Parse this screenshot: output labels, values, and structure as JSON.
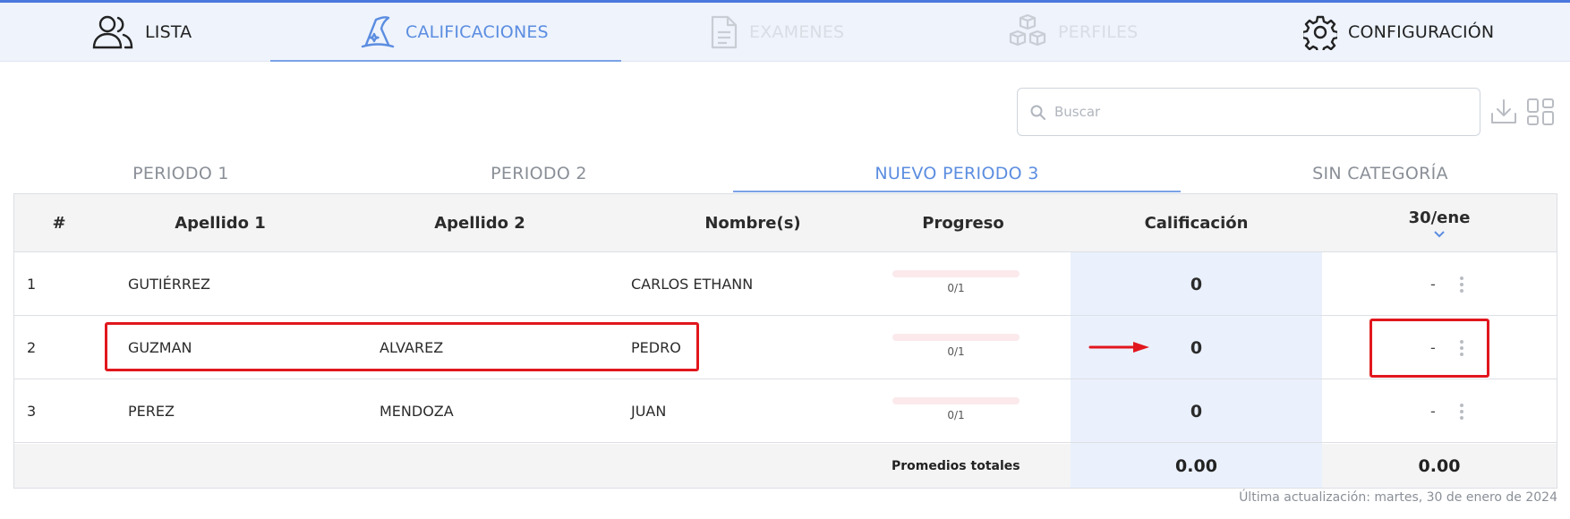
{
  "nav": {
    "items": [
      {
        "label": "LISTA",
        "icon": "users-icon"
      },
      {
        "label": "CALIFICACIONES",
        "icon": "wizard-hat-icon"
      },
      {
        "label": "EXAMENES",
        "icon": "document-icon"
      },
      {
        "label": "PERFILES",
        "icon": "cubes-icon"
      },
      {
        "label": "CONFIGURACIÓN",
        "icon": "gear-icon"
      }
    ],
    "active": "CALIFICACIONES"
  },
  "search": {
    "placeholder": "Buscar"
  },
  "tabs": {
    "items": [
      "PERIODO 1",
      "PERIODO 2",
      "NUEVO PERIODO 3",
      "SIN CATEGORÍA"
    ],
    "active": "NUEVO PERIODO 3"
  },
  "table": {
    "headers": [
      "#",
      "Apellido 1",
      "Apellido 2",
      "Nombre(s)",
      "Progreso",
      "Calificación",
      "30/ene"
    ],
    "rows": [
      {
        "num": "1",
        "apellido1": "GUTIÉRREZ",
        "apellido2": "",
        "nombre": "CARLOS ETHANN",
        "progreso": "0/1",
        "progress_fraction": 0,
        "calificacion": "0",
        "fecha": "-"
      },
      {
        "num": "2",
        "apellido1": "GUZMAN",
        "apellido2": "ALVAREZ",
        "nombre": "PEDRO",
        "progreso": "0/1",
        "progress_fraction": 0,
        "calificacion": "0",
        "fecha": "-"
      },
      {
        "num": "3",
        "apellido1": "PEREZ",
        "apellido2": "MENDOZA",
        "nombre": "JUAN",
        "progreso": "0/1",
        "progress_fraction": 0,
        "calificacion": "0",
        "fecha": "-"
      }
    ],
    "footer": {
      "label": "Promedios totales",
      "calificacion": "0.00",
      "fecha": "0.00"
    }
  },
  "status": {
    "last_updated": "Última actualización: martes, 30 de enero de 2024"
  },
  "colors": {
    "accent": "#5b8de0",
    "highlight": "#e1171d",
    "grade_column": "#eaf1fd"
  }
}
